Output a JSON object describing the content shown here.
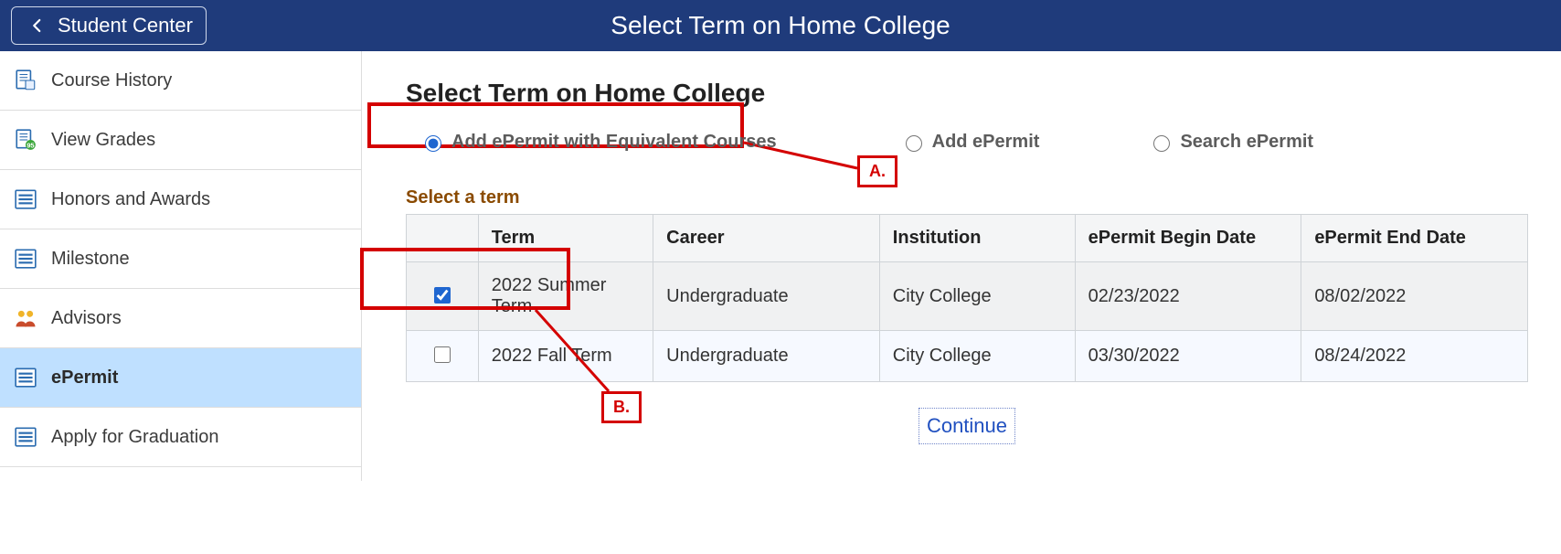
{
  "header": {
    "back_label": "Student Center",
    "title": "Select Term on Home College"
  },
  "sidebar": {
    "items": [
      {
        "label": "Course History",
        "icon": "doc-list-icon"
      },
      {
        "label": "View Grades",
        "icon": "doc-grade-icon"
      },
      {
        "label": "Honors and Awards",
        "icon": "lines-icon"
      },
      {
        "label": "Milestone",
        "icon": "lines-icon"
      },
      {
        "label": "Advisors",
        "icon": "people-icon"
      },
      {
        "label": "ePermit",
        "icon": "lines-icon"
      },
      {
        "label": "Apply for Graduation",
        "icon": "lines-icon"
      }
    ],
    "active_index": 5
  },
  "main": {
    "page_title": "Select Term on Home College",
    "radios": {
      "selected": "equiv",
      "equiv_label": "Add ePermit with Equivalent Courses",
      "add_label": "Add ePermit",
      "search_label": "Search ePermit"
    },
    "section_title": "Select a term",
    "table": {
      "headers": {
        "term": "Term",
        "career": "Career",
        "institution": "Institution",
        "begin": "ePermit Begin Date",
        "end": "ePermit End Date"
      },
      "rows": [
        {
          "checked": true,
          "term": "2022 Summer Term",
          "career": "Undergraduate",
          "institution": "City College",
          "begin": "02/23/2022",
          "end": "08/02/2022"
        },
        {
          "checked": false,
          "term": "2022 Fall Term",
          "career": "Undergraduate",
          "institution": "City College",
          "begin": "03/30/2022",
          "end": "08/24/2022"
        }
      ]
    },
    "continue_label": "Continue",
    "annotations": {
      "a": "A.",
      "b": "B."
    }
  }
}
